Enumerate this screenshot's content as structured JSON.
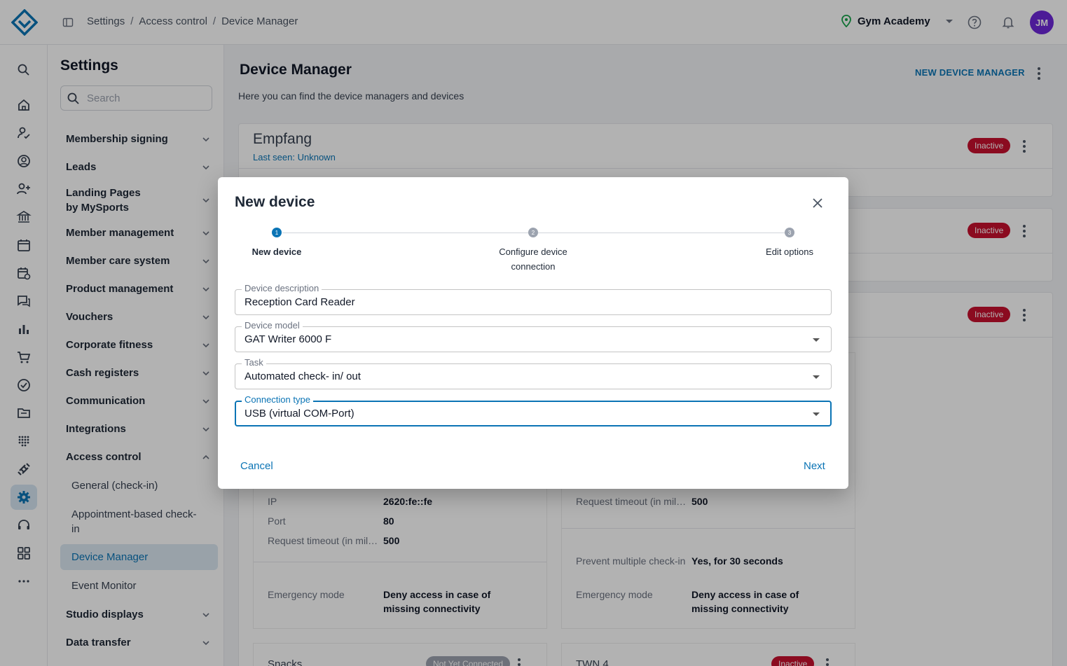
{
  "app": {
    "breadcrumb": [
      "Settings",
      "Access control",
      "Device Manager"
    ],
    "gym_name": "Gym Academy",
    "avatar_initials": "JM",
    "accent_color": "#0b74b5"
  },
  "rail_icons": [
    "search-icon",
    "home-icon",
    "user-check-icon",
    "user-circle-icon",
    "user-plus-icon",
    "bank-icon",
    "calendar-icon",
    "calendar-clock-icon",
    "chat-icon",
    "bar-chart-icon",
    "cart-icon",
    "check-circle-icon",
    "folder-icon",
    "grid-dots-icon",
    "dumbbell-icon",
    "gear-icon",
    "headset-icon",
    "apps-icon",
    "more-icon"
  ],
  "sidebar": {
    "title": "Settings",
    "search_placeholder": "Search",
    "items": [
      {
        "label": "Membership signing"
      },
      {
        "label": "Leads"
      },
      {
        "label": "Landing Pages by MySports"
      },
      {
        "label": "Member management"
      },
      {
        "label": "Member care system"
      },
      {
        "label": "Product management"
      },
      {
        "label": "Vouchers"
      },
      {
        "label": "Corporate fitness"
      },
      {
        "label": "Cash registers"
      },
      {
        "label": "Communication"
      },
      {
        "label": "Integrations"
      },
      {
        "label": "Access control"
      },
      {
        "label": "Studio displays"
      },
      {
        "label": "Data transfer"
      }
    ],
    "access_control_sub": [
      {
        "label": "General (check-in)"
      },
      {
        "label": "Appointment-based check-in"
      },
      {
        "label": "Device Manager"
      },
      {
        "label": "Event Monitor"
      }
    ]
  },
  "main": {
    "title": "Device Manager",
    "subtitle": "Here you can find the device managers and devices",
    "new_button": "NEW DEVICE MANAGER",
    "empfang": {
      "title": "Empfang",
      "last_seen": "Last seen: Unknown",
      "status": "Inactive"
    },
    "card2_status": "Inactive",
    "card3_status": "Inactive",
    "left_device": {
      "ip_label": "IP",
      "ip_value": "2620:fe::fe",
      "port_label": "Port",
      "port_value": "80",
      "timeout_label": "Request timeout (in mil…",
      "timeout_value": "500",
      "emergency_label": "Emergency mode",
      "emergency_value": "Deny access in case of missing connectivity"
    },
    "right_device": {
      "timeout_label": "Request timeout (in mil…",
      "timeout_value": "500",
      "prevent_label": "Prevent multiple check-in",
      "prevent_value": "Yes, for 30 seconds",
      "emergency_label": "Emergency mode",
      "emergency_value": "Deny access in case of missing connectivity"
    },
    "snacks": {
      "title": "Snacks",
      "status": "Not Yet Connected"
    },
    "twn4": {
      "title": "TWN 4",
      "status": "Inactive"
    }
  },
  "modal": {
    "title": "New device",
    "steps": [
      {
        "num": "1",
        "label": "New device"
      },
      {
        "num": "2",
        "label": "Configure device connection"
      },
      {
        "num": "3",
        "label": "Edit options"
      }
    ],
    "fields": {
      "description": {
        "label": "Device description",
        "value": "Reception Card Reader"
      },
      "model": {
        "label": "Device model",
        "value": "GAT Writer 6000 F"
      },
      "task": {
        "label": "Task",
        "value": "Automated check- in/ out"
      },
      "connection": {
        "label": "Connection type",
        "value": "USB (virtual COM-Port)"
      }
    },
    "cancel": "Cancel",
    "next": "Next"
  }
}
